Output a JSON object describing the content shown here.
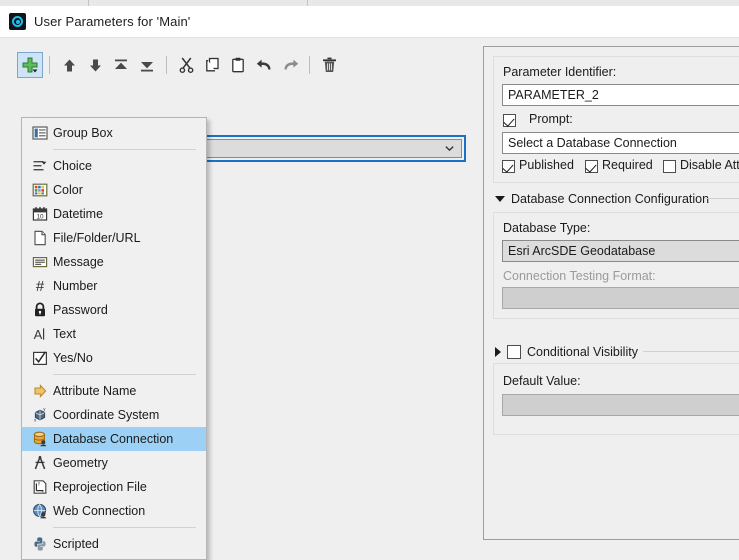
{
  "window": {
    "title": "User Parameters for 'Main'",
    "title_icon": "fme-parameter-icon"
  },
  "toolbar": {
    "items": [
      {
        "name": "add-parameter-button",
        "icon": "green-plus-dropdown-icon",
        "state": "active"
      },
      {
        "name": "move-up-button",
        "icon": "arrow-up-icon"
      },
      {
        "name": "move-down-button",
        "icon": "arrow-down-icon"
      },
      {
        "name": "move-to-top-button",
        "icon": "arrow-to-top-icon"
      },
      {
        "name": "move-to-bottom-button",
        "icon": "arrow-to-bottom-icon"
      },
      {
        "name": "cut-button",
        "icon": "scissors-icon"
      },
      {
        "name": "copy-button",
        "icon": "copy-icon"
      },
      {
        "name": "paste-button",
        "icon": "clipboard-icon"
      },
      {
        "name": "undo-button",
        "icon": "undo-arrow-icon"
      },
      {
        "name": "redo-button",
        "icon": "redo-arrow-icon"
      },
      {
        "name": "delete-button",
        "icon": "trash-icon"
      }
    ]
  },
  "add_menu": {
    "groups": [
      {
        "items": [
          {
            "label": "Group Box",
            "icon": "group-box-icon"
          }
        ]
      },
      {
        "items": [
          {
            "label": "Choice",
            "icon": "choice-icon"
          },
          {
            "label": "Color",
            "icon": "color-palette-icon"
          },
          {
            "label": "Datetime",
            "icon": "calendar-icon"
          },
          {
            "label": "File/Folder/URL",
            "icon": "file-icon"
          },
          {
            "label": "Message",
            "icon": "message-icon"
          },
          {
            "label": "Number",
            "icon": "hash-icon"
          },
          {
            "label": "Password",
            "icon": "lock-icon"
          },
          {
            "label": "Text",
            "icon": "text-cursor-icon"
          },
          {
            "label": "Yes/No",
            "icon": "checkbox-icon"
          }
        ]
      },
      {
        "items": [
          {
            "label": "Attribute Name",
            "icon": "attribute-arrow-icon"
          },
          {
            "label": "Coordinate System",
            "icon": "coordinate-system-icon"
          },
          {
            "label": "Database Connection",
            "icon": "database-connection-icon",
            "selected": true
          },
          {
            "label": "Geometry",
            "icon": "compass-icon"
          },
          {
            "label": "Reprojection File",
            "icon": "reprojection-file-icon"
          },
          {
            "label": "Web Connection",
            "icon": "web-globe-icon"
          }
        ]
      },
      {
        "items": [
          {
            "label": "Scripted",
            "icon": "python-icon"
          }
        ]
      }
    ]
  },
  "combo": {
    "value": "",
    "icon": "chevron-down-icon"
  },
  "properties": {
    "identifier_label": "Parameter Identifier:",
    "identifier_value": "PARAMETER_2",
    "prompt_label": "Prompt:",
    "prompt_checked": true,
    "prompt_value": "Select a Database Connection",
    "flags": [
      {
        "label": "Published",
        "checked": true
      },
      {
        "label": "Required",
        "checked": true
      },
      {
        "label": "Disable Attri",
        "checked": false
      }
    ],
    "db_section_title": "Database Connection Configuration",
    "db_section_expanded": true,
    "database_type_label": "Database Type:",
    "database_type_value": "Esri ArcSDE Geodatabase",
    "connection_testing_label": "Connection Testing Format:",
    "connection_testing_value": "",
    "conditional_visibility_title": "Conditional Visibility",
    "conditional_visibility_checked": false,
    "conditional_visibility_expanded": false,
    "default_value_label": "Default Value:",
    "default_value": ""
  },
  "colors": {
    "accent_blue": "#1b72c4",
    "selection_blue": "#9cd1f5",
    "toolbar_active": "#cde3f7",
    "panel_bg": "#efefef",
    "title_bg": "#ffffff",
    "plus_green": "#3faa3f"
  }
}
